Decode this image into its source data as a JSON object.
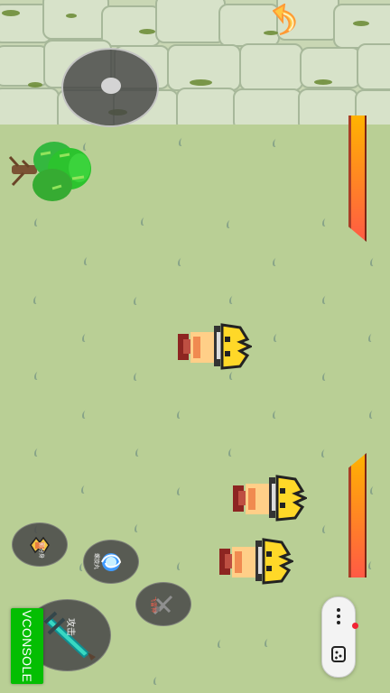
{
  "game": {
    "title": "",
    "skills": [
      {
        "label": "影分身",
        "icon": "shadow-clone-icon"
      },
      {
        "label": "螺旋丸",
        "icon": "rasengan-icon"
      },
      {
        "label": "飞雷神",
        "icon": "kunai-icon"
      },
      {
        "label": "攻击",
        "icon": "sword-icon"
      }
    ],
    "hud": {
      "top_health_fraction": 1.0,
      "bottom_health_fraction": 1.0,
      "jump_icon": "curved-arrow-icon",
      "joystick_icon": "joystick-icon"
    }
  },
  "vconsole": {
    "label": "VCONSOLE"
  },
  "mini_program_menu": {
    "more_icon": "more-vertical-icon",
    "game_icon": "game-controller-icon"
  },
  "colors": {
    "grass": "#b9cf95",
    "health": "#ff7a36",
    "vconsole": "#04be02"
  }
}
